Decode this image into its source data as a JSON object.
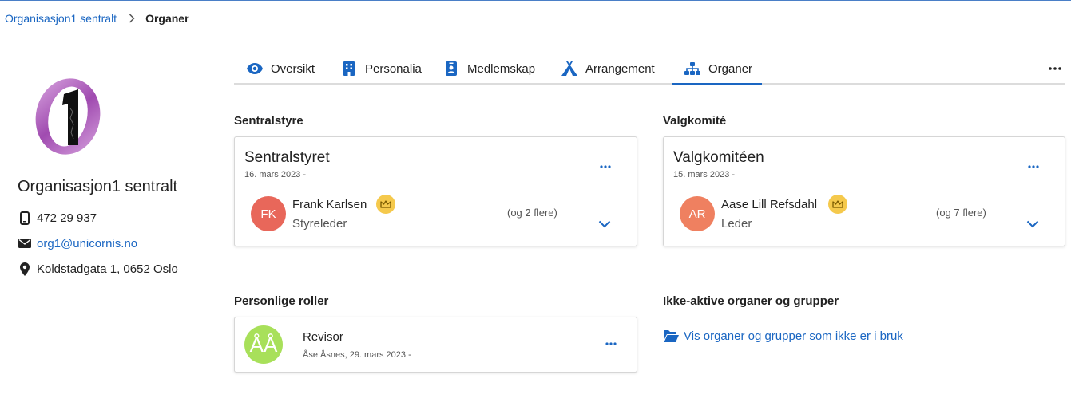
{
  "breadcrumb": {
    "parent": "Organisasjon1 sentralt",
    "current": "Organer"
  },
  "profile": {
    "logo_icon": "organisation-logo",
    "name": "Organisasjon1 sentralt",
    "phone": "472 29 937",
    "email": "org1@unicornis.no",
    "address": "Koldstadgata 1, 0652 Oslo"
  },
  "tabs": [
    {
      "label": "Oversikt",
      "icon": "eye-icon"
    },
    {
      "label": "Personalia",
      "icon": "building-icon"
    },
    {
      "label": "Medlemskap",
      "icon": "id-badge-icon"
    },
    {
      "label": "Arrangement",
      "icon": "tent-icon"
    },
    {
      "label": "Organer",
      "icon": "sitemap-icon",
      "active": true
    }
  ],
  "sections": {
    "sentralstyre": {
      "heading": "Sentralstyre",
      "card": {
        "title": "Sentralstyret",
        "date": "16. mars 2023 -",
        "person": {
          "initials": "FK",
          "name": "Frank Karlsen",
          "role": "Styreleder",
          "avatar_color": "#e8675a"
        },
        "more": "(og 2 flere)"
      }
    },
    "valgkomite": {
      "heading": "Valgkomité",
      "card": {
        "title": "Valgkomitéen",
        "date": "15. mars 2023 -",
        "person": {
          "initials": "AR",
          "name": "Aase Lill Refsdahl",
          "role": "Leder",
          "avatar_color": "#ef8060"
        },
        "more": "(og 7 flere)"
      }
    },
    "personlige": {
      "heading": "Personlige roller",
      "card": {
        "initials": "ÅÅ",
        "avatar_color": "#a8e05a",
        "title": "Revisor",
        "subtitle": "Åse Åsnes, 29. mars 2023 -"
      }
    },
    "ikke_aktive": {
      "heading": "Ikke-aktive organer og grupper",
      "link": "Vis organer og grupper som ikke er i bruk"
    }
  },
  "colors": {
    "accent": "#1a66c2",
    "crown": "#f5c94c"
  }
}
